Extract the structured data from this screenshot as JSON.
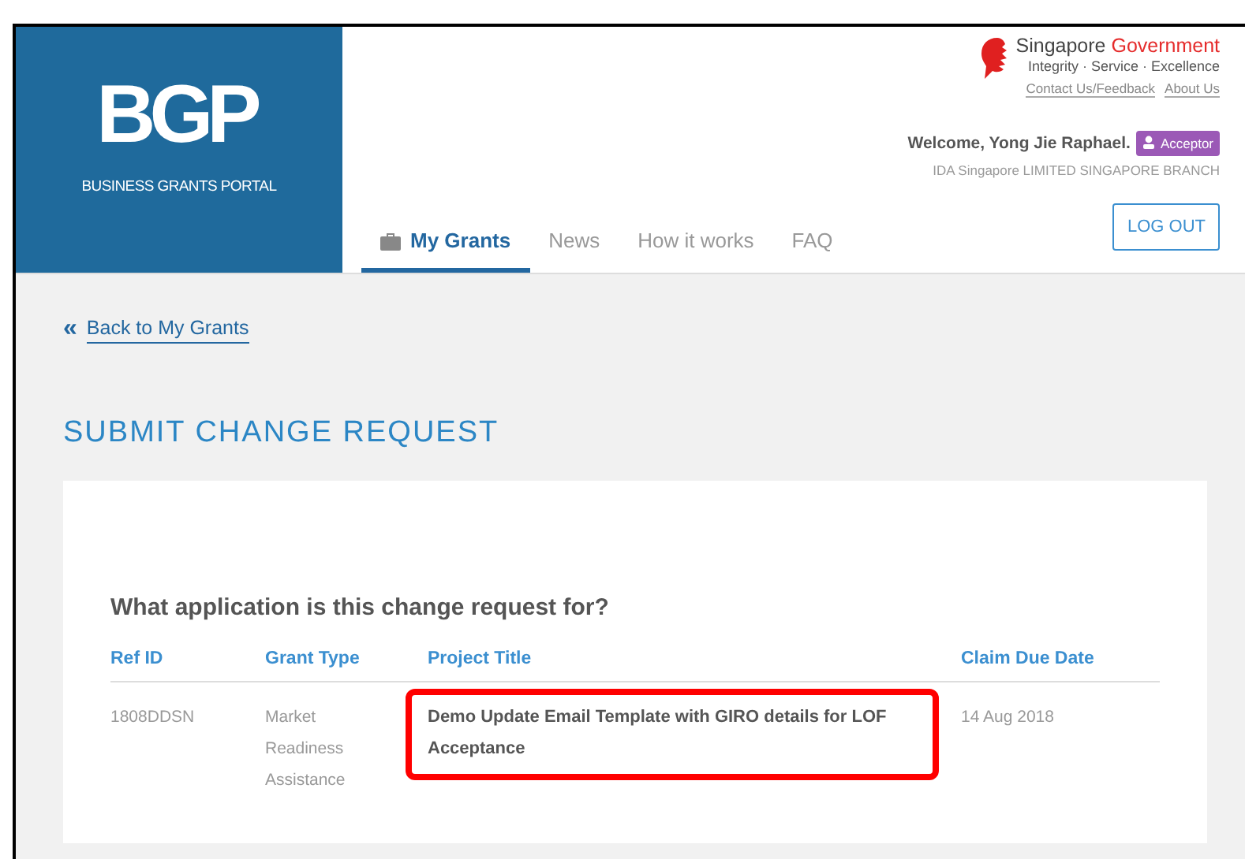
{
  "logo": {
    "mark": "BGP",
    "name": "BUSINESS GRANTS PORTAL"
  },
  "government": {
    "name_part1": "Singapore",
    "name_part2": "Government",
    "motto": "Integrity · Service · Excellence",
    "links": [
      "Contact Us/Feedback",
      "About Us"
    ]
  },
  "user": {
    "welcome": "Welcome, Yong Jie Raphael.",
    "role": "Acceptor",
    "company": "IDA Singapore LIMITED SINGAPORE BRANCH"
  },
  "nav": [
    {
      "label": "My Grants",
      "selected": true,
      "kind": "briefcase"
    },
    {
      "label": "News",
      "selected": false
    },
    {
      "label": "How it works",
      "selected": false
    },
    {
      "label": "FAQ",
      "selected": false
    }
  ],
  "logout": "LOG OUT",
  "back_link": {
    "icon": "«",
    "label": "Back to My Grants"
  },
  "page_title": "SUBMIT CHANGE REQUEST",
  "question": "What application is this change request for?",
  "table": {
    "columns": [
      "Ref ID",
      "Grant Type",
      "Project Title",
      "Claim Due Date"
    ],
    "rows": [
      {
        "cells": [
          {
            "text": "1808DDSN",
            "highlighted": false
          },
          {
            "text": "Market Readiness Assistance",
            "highlighted": false
          },
          {
            "text": "Demo Update Email Template with GIRO details for LOF Acceptance",
            "highlighted": true
          },
          {
            "text": "14 Aug 2018",
            "highlighted": false
          }
        ]
      }
    ]
  }
}
